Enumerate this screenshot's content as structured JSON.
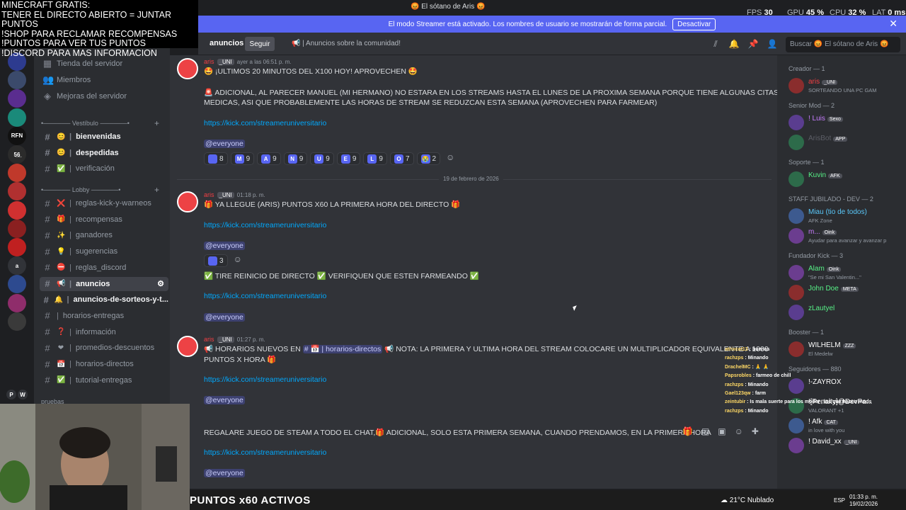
{
  "window": {
    "title": "😡 El sótano de Aris 😡"
  },
  "perf": {
    "fps_label": "FPS",
    "fps": "30",
    "gpu_label": "GPU",
    "gpu": "45 %",
    "cpu_label": "CPU",
    "cpu": "32 %",
    "lat_label": "LAT",
    "lat": "0 ms"
  },
  "banner": {
    "text": "El modo Streamer está activado. Los nombres de usuario se mostrarán de forma parcial.",
    "button": "Desactivar"
  },
  "overlay": {
    "lines": [
      "MINECRAFT GRATIS:",
      "TENER EL DIRECTO ABIERTO = JUNTAR PUNTOS",
      "!SHOP PARA RECLAMAR RECOMPENSAS",
      "!PUNTOS PARA VER TUS PUNTOS",
      "!DISCORD PARA MAS INFORMACION"
    ]
  },
  "servers": [
    {
      "label": "",
      "badge": "32",
      "color": "#2d3b8f"
    },
    {
      "label": "",
      "badge": "29",
      "color": "#3b4a6b"
    },
    {
      "label": "",
      "badge": "201",
      "color": "#5a2d8f"
    },
    {
      "label": "",
      "badge": "",
      "color": "#1a8a7a"
    },
    {
      "label": "RFN",
      "badge": "4",
      "color": "#111111"
    },
    {
      "label": "5̲6̲",
      "badge": "",
      "color": "#2b2b2b"
    },
    {
      "label": "",
      "badge": "21",
      "color": "#c0392b"
    },
    {
      "label": "",
      "badge": "19",
      "color": "#b03030"
    },
    {
      "label": "",
      "badge": "",
      "color": "#d03030"
    },
    {
      "label": "",
      "badge": "17",
      "color": "#8a2020"
    },
    {
      "label": "",
      "badge": "",
      "color": "#c02020"
    },
    {
      "label": "a",
      "badge": "",
      "color": "#313338"
    },
    {
      "label": "",
      "badge": "510",
      "color": "#2d4a8f"
    },
    {
      "label": "",
      "badge": "463",
      "color": "#8f2d6b"
    },
    {
      "label": "",
      "badge": "2",
      "color": "#3a3a3a"
    }
  ],
  "server_footer": {
    "p": "P",
    "w": "W"
  },
  "channels": {
    "top": [
      {
        "icon": "📅",
        "label": "Tienda del servidor"
      },
      {
        "icon": "👥",
        "label": "Miembros"
      },
      {
        "icon": "🛡",
        "label": "Mejoras del servidor"
      }
    ],
    "cat_vestibulo": "•────── Vestíbulo ──────•",
    "vestibulo": [
      {
        "emoji": "😊",
        "label": "bienvenidas",
        "unread": true
      },
      {
        "emoji": "😊",
        "label": "despedidas",
        "unread": true
      },
      {
        "emoji": "✅",
        "label": "verificación",
        "unread": false
      }
    ],
    "cat_lobby": "•────── Lobby ──────•",
    "lobby": [
      {
        "emoji": "❌",
        "label": "reglas-kick-y-warneos",
        "unread": false
      },
      {
        "emoji": "🎁",
        "label": "recompensas",
        "unread": false
      },
      {
        "emoji": "✨",
        "label": "ganadores",
        "unread": false
      },
      {
        "emoji": "💡",
        "label": "sugerencias",
        "unread": false
      },
      {
        "emoji": "⛔",
        "label": "reglas_discord",
        "unread": false
      },
      {
        "emoji": "📢",
        "label": "anuncios",
        "unread": true,
        "active": true
      },
      {
        "emoji": "🔔",
        "label": "anuncios-de-sorteos-y-t...",
        "unread": true
      },
      {
        "emoji": "",
        "label": "horarios-entregas",
        "unread": false
      },
      {
        "emoji": "❓",
        "label": "información",
        "unread": false
      },
      {
        "emoji": "❤",
        "label": "promedios-descuentos",
        "unread": false
      },
      {
        "emoji": "📅",
        "label": "horarios-directos",
        "unread": false
      },
      {
        "emoji": "✅",
        "label": "tutorial-entregas",
        "unread": false
      }
    ],
    "cat_pruebas": "pruebas"
  },
  "header": {
    "channel": "anuncios",
    "follow": "Seguir",
    "topic": "📢 | Anuncios sobre la comunidad!",
    "search": "Buscar 😡 El sótano de Aris 😡"
  },
  "messages": [
    {
      "author": "aris",
      "tag": "_UNI",
      "time": "ayer a las 06:51 p. m.",
      "lines": [
        "🤩 ¡ULTIMOS 20 MINUTOS DEL X100 HOY! APROVECHEN 🤩",
        "",
        "🚨 ADICIONAL, AL PARECER MANUEL (MI HERMANO) NO ESTARA EN LOS STREAMS HASTA EL LUNES DE LA PROXIMA SEMANA PORQUE TIENE ALGUNAS CITAS",
        "MEDICAS, ASI QUE PROBABLEMENTE LAS HORAS DE STREAM SE REDUZCAN ESTA SEMANA (APROVECHEN PARA FARMEAR)"
      ],
      "link": "https://kick.com/streameruniversitario",
      "mention": "@everyone",
      "reactions": [
        {
          "e": "",
          "n": "8"
        },
        {
          "e": "M",
          "n": "9"
        },
        {
          "e": "A",
          "n": "9"
        },
        {
          "e": "N",
          "n": "9"
        },
        {
          "e": "U",
          "n": "9"
        },
        {
          "e": "E",
          "n": "9"
        },
        {
          "e": "L",
          "n": "9"
        },
        {
          "e": "O",
          "n": "7"
        },
        {
          "e": "😭",
          "n": "2"
        }
      ]
    },
    {
      "date": "19 de febrero de 2026"
    },
    {
      "author": "aris",
      "tag": "_UNI",
      "time": "01:18 p. m.",
      "lines": [
        "🎁 YA LLEGUE (ARIS) PUNTOS X60 LA PRIMERA HORA DEL DIRECTO 🎁"
      ],
      "link": "https://kick.com/streameruniversitario",
      "mention": "@everyone",
      "reactions": [
        {
          "e": "",
          "n": "3"
        }
      ],
      "line2": "✅ TIRE REINICIO DE DIRECTO ✅ VERIFIQUEN QUE ESTEN FARMEANDO ✅",
      "link2": "https://kick.com/streameruniversitario",
      "mention2": "@everyone"
    },
    {
      "author": "aris",
      "tag": "_UNI",
      "time": "01:27 p. m.",
      "line_a": "📢 HORARIOS NUEVOS EN",
      "channel_ref": "# 📅 | horarios-directos",
      "line_b": "📢 NOTA: LA PRIMERA Y ULTIMA HORA DEL STREAM COLOCARE UN MULTIPLICADOR EQUIVALENTE A 1000",
      "line_c": "PUNTOS X HORA 🎁",
      "link": "https://kick.com/streameruniversitario",
      "mention": "@everyone"
    },
    {
      "lines": [
        "REGALARE JUEGO DE STEAM A TODO EL CHAT,🎁 ADICIONAL, SOLO ESTA PRIMERA SEMANA, CUANDO PRENDAMOS, EN LA PRIMERA HORA"
      ],
      "link": "https://kick.com/streameruniversitario",
      "mention": "@everyone"
    }
  ],
  "members": {
    "groups": [
      {
        "title": "Creador — 1",
        "items": [
          {
            "name": "aris",
            "tag": "_UNI",
            "status": "SORTEANDO UNA PC GAM",
            "color": "#f23f43"
          }
        ]
      },
      {
        "title": "Senior Mod — 2",
        "items": [
          {
            "name": "! Luis",
            "tag": "Sexo",
            "status": "",
            "color": "#c77dff"
          },
          {
            "name": "ArisBot",
            "tag": "APP",
            "status": "",
            "color": "#5c5e66"
          }
        ]
      },
      {
        "title": "Soporte — 1",
        "items": [
          {
            "name": "Kuvin",
            "tag": "AFK",
            "status": "",
            "color": "#57f287"
          }
        ]
      },
      {
        "title": "STAFF JUBILADO - DEV — 2",
        "items": [
          {
            "name": "Miau (tio de todos)",
            "tag": "",
            "status": "AFK Zone",
            "color": "#5ac8fa"
          },
          {
            "name": "m...",
            "tag": "Oink",
            "status": "Ayudar para avanzar y avanzar p",
            "color": "#c77dff"
          }
        ]
      },
      {
        "title": "Fundador Kick — 3",
        "items": [
          {
            "name": "Alam",
            "tag": "Oink",
            "status": "\"Se mi San Valentin...\"",
            "color": "#57f287"
          },
          {
            "name": "John Doe",
            "tag": "META",
            "status": "",
            "color": "#57f287"
          },
          {
            "name": "zLautyel",
            "tag": "",
            "status": "",
            "color": "#57f287"
          }
        ]
      },
      {
        "title": "Booster — 1",
        "items": [
          {
            "name": "WILHELM",
            "tag": "ZZZ",
            "status": "El Medelw",
            "color": "#ffffff"
          }
        ]
      },
      {
        "title": "Seguidores — 880",
        "items": [
          {
            "name": "!-ZAYROX",
            "tag": "",
            "status": "",
            "color": "#ffffff"
          },
          {
            "name": "![Penalty]@DevPa...",
            "tag": "",
            "status": "VALORANT +1",
            "color": "#ffffff"
          },
          {
            "name": "! Afk",
            "tag": "CAT",
            "status": "in love with you",
            "color": "#ffffff"
          },
          {
            "name": "! David_xx",
            "tag": "_UNI",
            "status": "",
            "color": "#ffffff"
          }
        ]
      }
    ]
  },
  "stream_chat": [
    {
      "user": "atrixcat13",
      "text": "buenas"
    },
    {
      "user": "rachzps",
      "text": "Minando"
    },
    {
      "user": "DrachelMC",
      "text": "🙏 🙏"
    },
    {
      "user": "Papsrobles",
      "text": "farmeo de chill"
    },
    {
      "user": "rachzps",
      "text": "Minando"
    },
    {
      "user": "Gael123qw",
      "text": "farm"
    },
    {
      "user": "zeintubir",
      "text": "Is mala suerte para los moder , los que hacen mods"
    },
    {
      "user": "rachzps",
      "text": "Minando"
    }
  ],
  "bottom_text": "PUNTOS x60 ACTIVOS",
  "taskbar": {
    "weather": "21°C Nublado",
    "lang": "ESP",
    "time": "01:33 p. m.",
    "date": "19/02/2026"
  }
}
